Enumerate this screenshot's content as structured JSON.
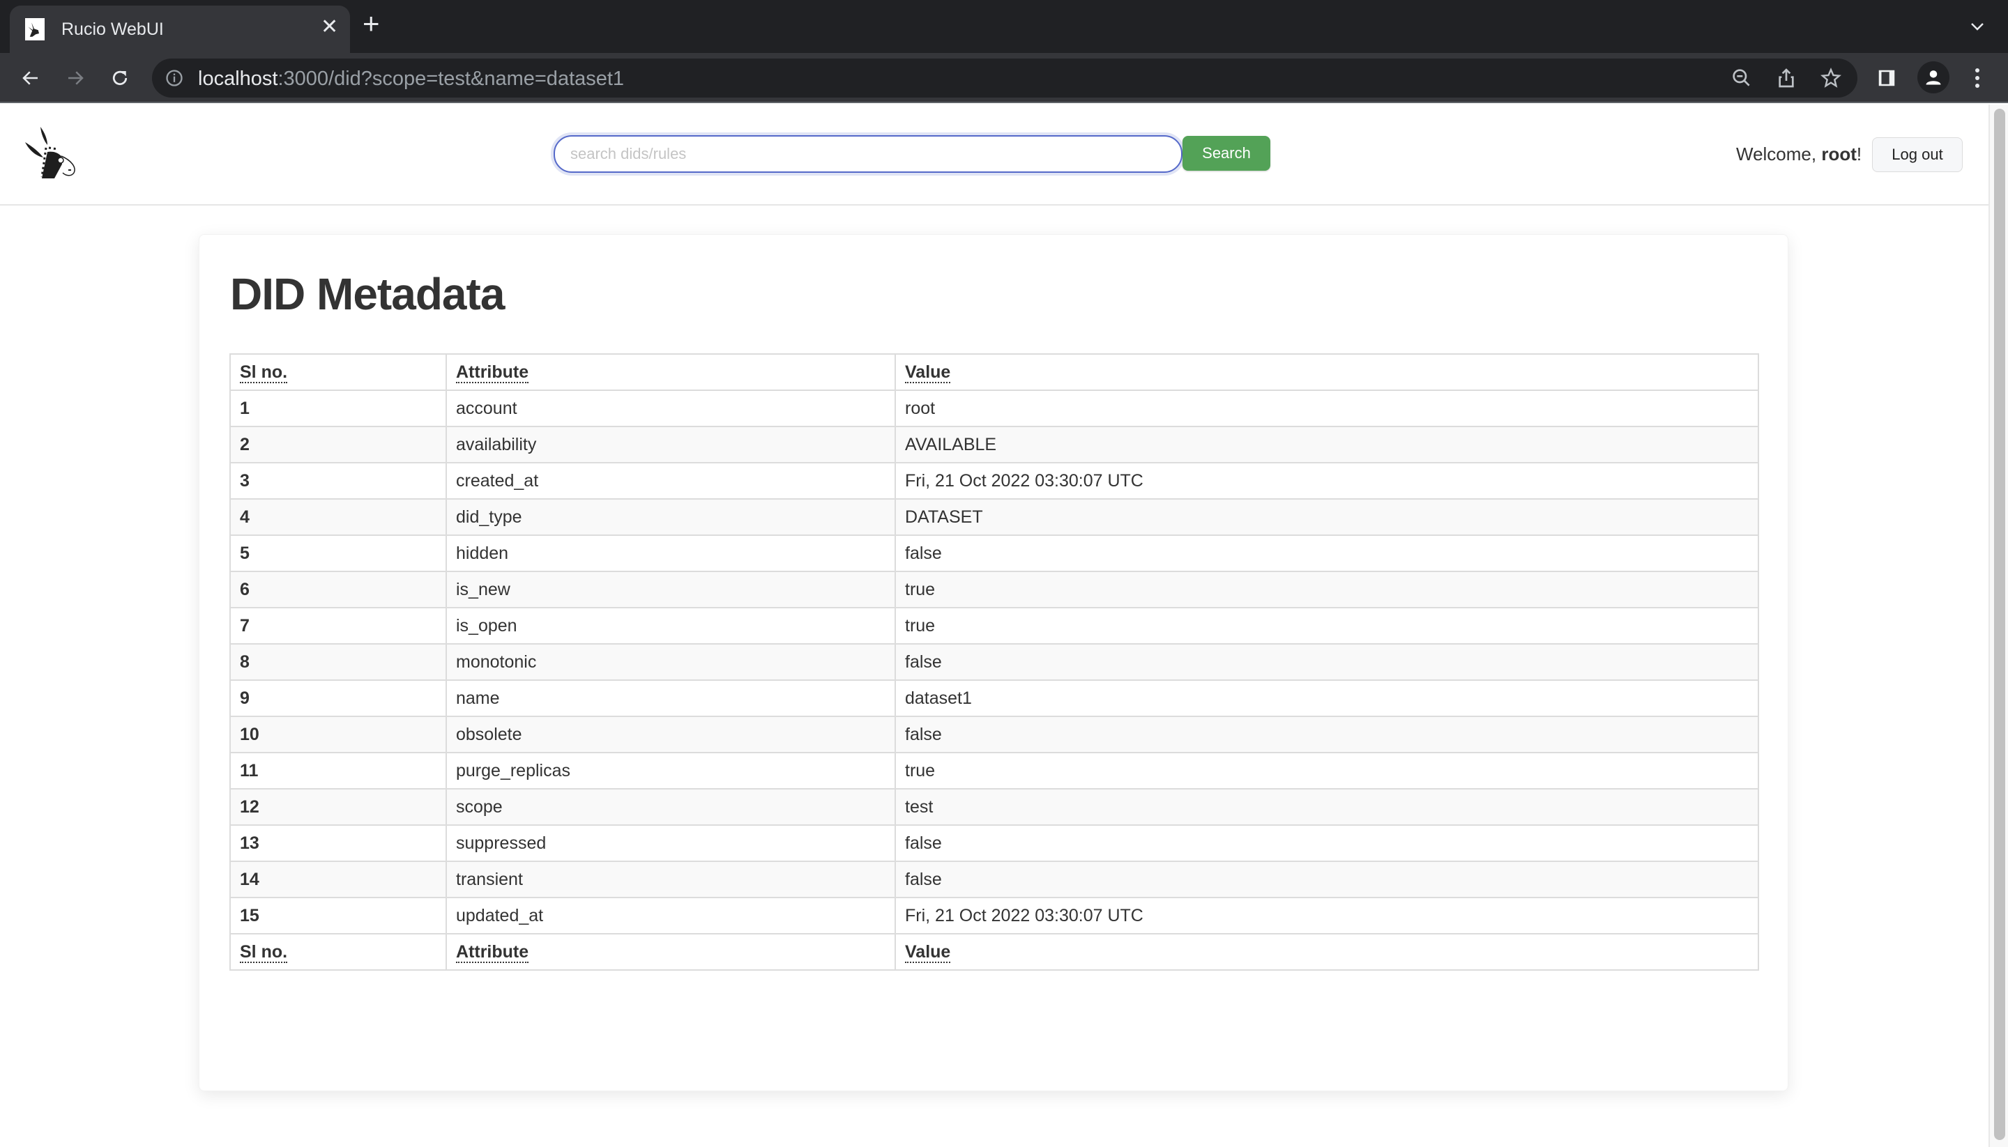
{
  "browser": {
    "tab_title": "Rucio WebUI",
    "url_host": "localhost",
    "url_rest": ":3000/did?scope=test&name=dataset1",
    "icons": [
      "back-icon",
      "forward-icon",
      "reload-icon",
      "info-icon",
      "zoom-out-icon",
      "share-icon",
      "bookmark-star-icon",
      "side-panel-icon",
      "profile-icon",
      "menu-icon"
    ]
  },
  "header": {
    "search_placeholder": "search dids/rules",
    "search_value": "",
    "search_button": "Search",
    "welcome_prefix": "Welcome, ",
    "username": "root",
    "welcome_suffix": "!",
    "logout_button": "Log out",
    "accent_color": "#53a257"
  },
  "main": {
    "title": "DID Metadata",
    "columns": [
      "Sl no.",
      "Attribute",
      "Value"
    ],
    "rows": [
      {
        "n": "1",
        "attr": "account",
        "value": "root"
      },
      {
        "n": "2",
        "attr": "availability",
        "value": "AVAILABLE"
      },
      {
        "n": "3",
        "attr": "created_at",
        "value": "Fri, 21 Oct 2022 03:30:07 UTC"
      },
      {
        "n": "4",
        "attr": "did_type",
        "value": "DATASET"
      },
      {
        "n": "5",
        "attr": "hidden",
        "value": "false"
      },
      {
        "n": "6",
        "attr": "is_new",
        "value": "true"
      },
      {
        "n": "7",
        "attr": "is_open",
        "value": "true"
      },
      {
        "n": "8",
        "attr": "monotonic",
        "value": "false"
      },
      {
        "n": "9",
        "attr": "name",
        "value": "dataset1"
      },
      {
        "n": "10",
        "attr": "obsolete",
        "value": "false"
      },
      {
        "n": "11",
        "attr": "purge_replicas",
        "value": "true"
      },
      {
        "n": "12",
        "attr": "scope",
        "value": "test"
      },
      {
        "n": "13",
        "attr": "suppressed",
        "value": "false"
      },
      {
        "n": "14",
        "attr": "transient",
        "value": "false"
      },
      {
        "n": "15",
        "attr": "updated_at",
        "value": "Fri, 21 Oct 2022 03:30:07 UTC"
      }
    ]
  }
}
